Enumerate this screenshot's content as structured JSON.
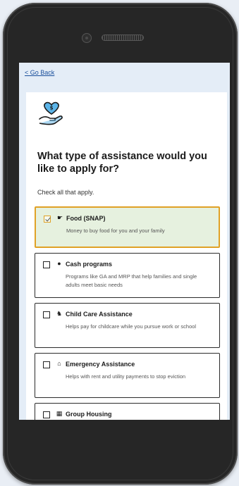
{
  "nav": {
    "back_label": "< Go Back"
  },
  "page": {
    "title": "What type of assistance would you like to apply for?",
    "hint": "Check all that apply."
  },
  "options": [
    {
      "title": "Food (SNAP)",
      "description": "Money to buy food for you and your family",
      "checked": true,
      "icon": "hand-pointer-icon"
    },
    {
      "title": "Cash programs",
      "description": "Programs like GA and MRP that help families and single adults meet basic needs",
      "checked": false,
      "icon": "dollar-circle-icon"
    },
    {
      "title": "Child Care Assistance",
      "description": "Helps pay for childcare while you pursue work or school",
      "checked": false,
      "icon": "child-icon"
    },
    {
      "title": "Emergency Assistance",
      "description": "Helps with rent and utility payments to stop eviction",
      "checked": false,
      "icon": "home-icon"
    },
    {
      "title": "Group Housing",
      "description": "",
      "checked": false,
      "icon": "building-icon"
    }
  ],
  "colors": {
    "selected_border": "#e0a126",
    "selected_background": "#e6f1df",
    "link": "#1a4f9c",
    "icon_accent": "#5bb4e8"
  }
}
